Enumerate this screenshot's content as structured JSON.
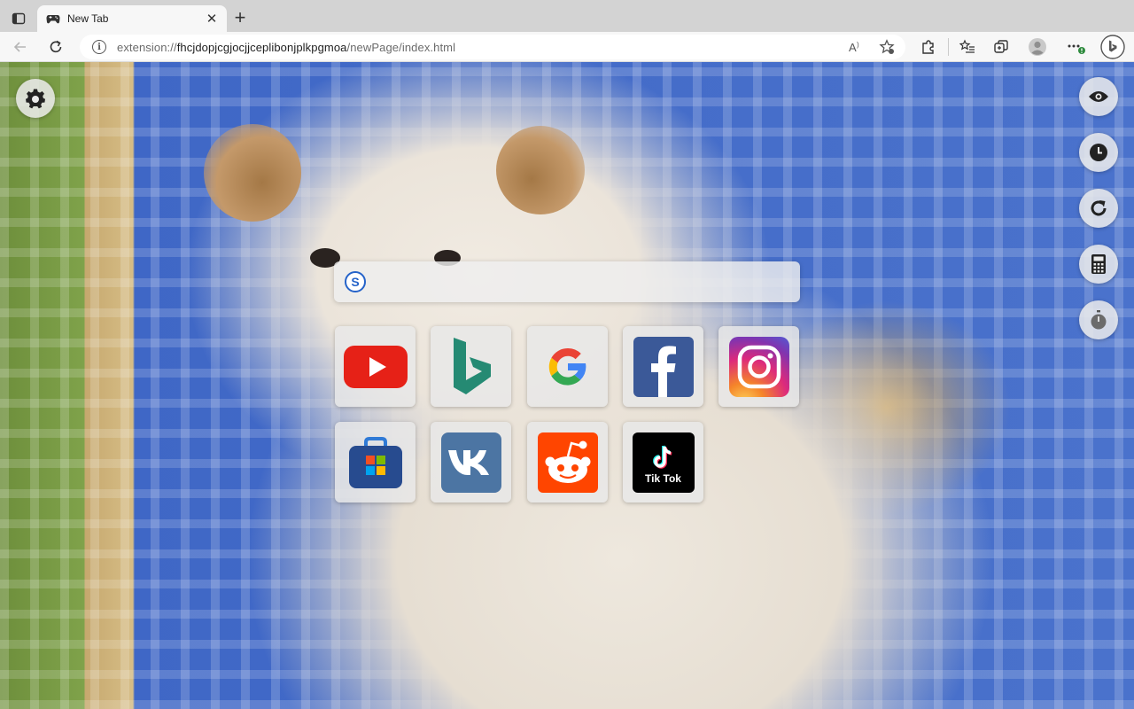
{
  "browser": {
    "tab": {
      "title": "New Tab",
      "close_label": "✕"
    },
    "new_tab_label": "+",
    "address": {
      "scheme": "extension://",
      "host": "fhcjdopjcgjocjjceplibonjplkpgmoa",
      "path": "/newPage/index.html"
    }
  },
  "page": {
    "search": {
      "engine_letter": "S",
      "placeholder": "",
      "value": ""
    },
    "shortcuts": [
      {
        "name": "YouTube",
        "color": "#e62117"
      },
      {
        "name": "Bing",
        "color": "#258a73"
      },
      {
        "name": "Google",
        "color": "#4285f4"
      },
      {
        "name": "Facebook",
        "color": "#3b5998"
      },
      {
        "name": "Instagram",
        "color": "#c13584"
      },
      {
        "name": "Microsoft Store",
        "color": "#2a4d8f"
      },
      {
        "name": "VK",
        "color": "#4c75a3"
      },
      {
        "name": "Reddit",
        "color": "#ff4500"
      },
      {
        "name": "TikTok",
        "color": "#000000",
        "label": "Tik Tok"
      }
    ],
    "side_buttons": [
      "eye-icon",
      "clock-icon",
      "refresh-icon",
      "calculator-icon",
      "stopwatch-icon"
    ],
    "settings_icon": "gear-icon"
  }
}
